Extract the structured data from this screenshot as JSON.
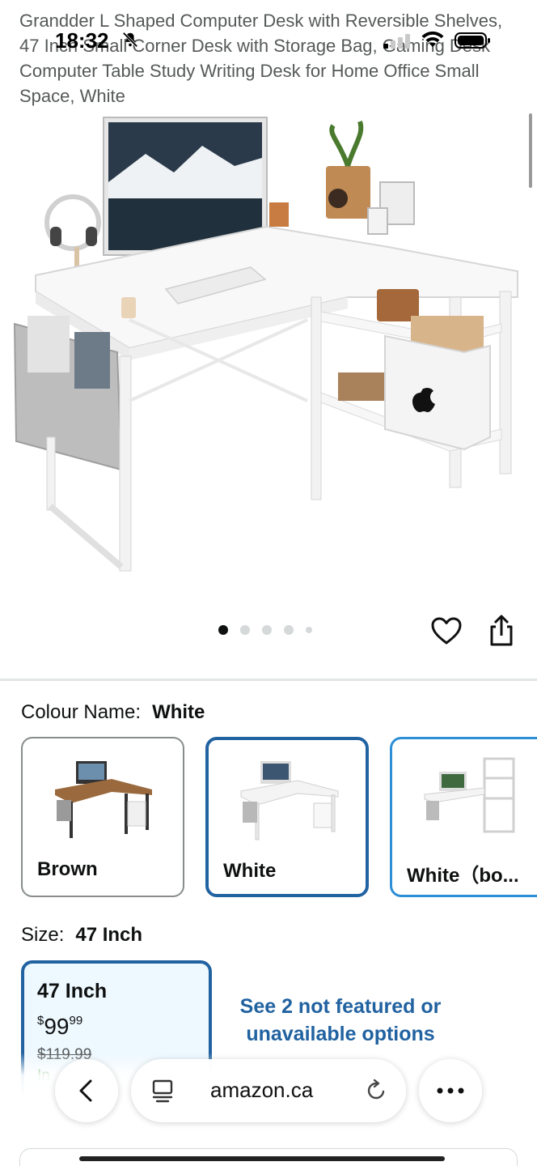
{
  "status_bar": {
    "time": "18:32"
  },
  "product": {
    "title": "Grandder L Shaped Computer Desk with Reversible Shelves, 47 Inch Small Corner Desk with Storage Bag, Gaming Desk Computer Table Study Writing Desk for Home Office Small Space, White",
    "image_count": 5,
    "active_image": 1
  },
  "colour": {
    "label": "Colour Name:",
    "selected": "White",
    "options": [
      {
        "label": "Brown"
      },
      {
        "label": "White"
      },
      {
        "label": "White（bo..."
      }
    ]
  },
  "size": {
    "label": "Size:",
    "selected": "47 Inch",
    "card": {
      "name": "47 Inch",
      "price_symbol": "$",
      "price_whole": "99",
      "price_cents": "99",
      "was_price": "$119.99",
      "stock": "In"
    },
    "see_more": "See 2 not featured or unavailable options"
  },
  "browser": {
    "url": "amazon.ca"
  },
  "colors": {
    "accent": "#2162a1",
    "selected_bg": "#edf8ff",
    "text": "#0f1111",
    "muted": "#565959"
  },
  "icons": [
    "bell-off-icon",
    "signal-icon",
    "wifi-icon",
    "battery-icon",
    "heart-icon",
    "share-icon",
    "back-icon",
    "tabs-icon",
    "reload-icon",
    "more-icon"
  ]
}
